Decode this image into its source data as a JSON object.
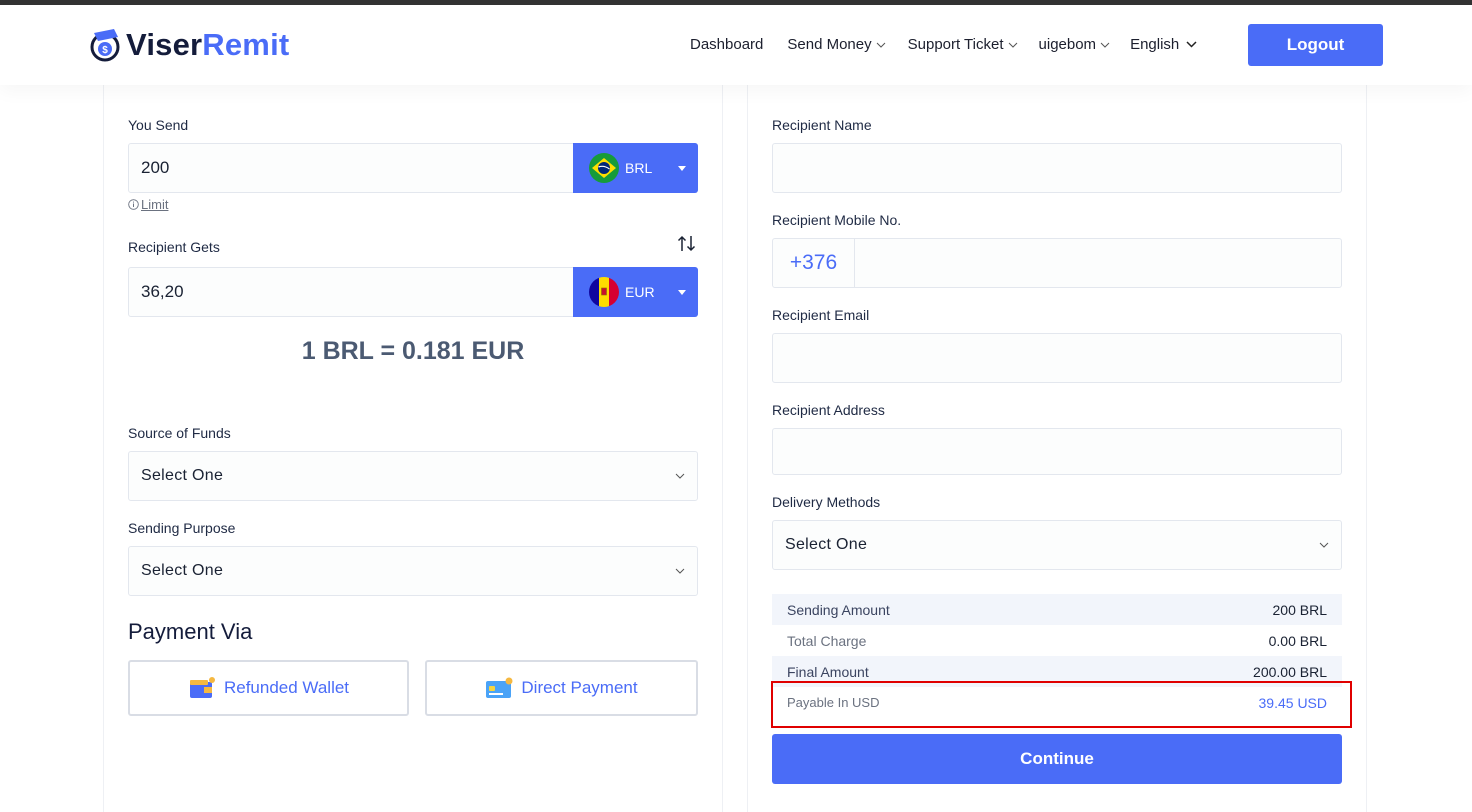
{
  "header": {
    "logo_part1": "Viser",
    "logo_part2": "Remit",
    "nav": [
      "Dashboard",
      "Send Money",
      "Support Ticket",
      "uigebom",
      "English"
    ],
    "logout_label": "Logout"
  },
  "send": {
    "you_send_label": "You Send",
    "you_send_value": "200",
    "send_currency": "BRL",
    "limit_label": " Limit",
    "recipient_gets_label": "Recipient Gets",
    "recipient_gets_value": "36,20",
    "receive_currency": "EUR",
    "rate_text": "1 BRL = 0.181 EUR",
    "source_label": "Source of Funds",
    "source_value": "Select One",
    "purpose_label": "Sending Purpose",
    "purpose_value": "Select One",
    "payment_via_label": "Payment Via",
    "refunded_wallet_label": "Refunded Wallet",
    "direct_payment_label": "Direct Payment"
  },
  "recipient": {
    "name_label": "Recipient Name",
    "mobile_label": "Recipient Mobile No.",
    "mobile_code": "+376",
    "email_label": "Recipient Email",
    "address_label": "Recipient Address",
    "delivery_label": "Delivery Methods",
    "delivery_value": "Select One"
  },
  "summary": {
    "sending_amount_label": "Sending Amount",
    "sending_amount_value": "200 BRL",
    "total_charge_label": "Total Charge",
    "total_charge_value": "0.00 BRL",
    "final_amount_label": "Final Amount",
    "final_amount_value": "200.00 BRL",
    "payable_label": "Payable In USD",
    "payable_value": "39.45 USD"
  },
  "continue_label": "Continue",
  "colors": {
    "accent": "#4a6cf7",
    "highlight": "#e00000"
  }
}
